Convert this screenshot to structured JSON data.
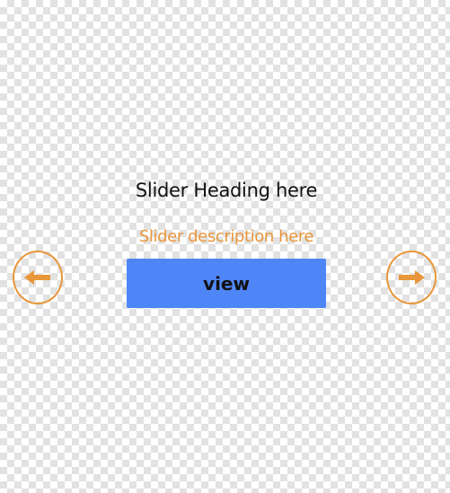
{
  "slider": {
    "heading": "Slider Heading here",
    "description": "Slider description here",
    "button_label": "view",
    "prev_icon": "arrow-left-icon",
    "next_icon": "arrow-right-icon"
  },
  "colors": {
    "accent": "#e8963a",
    "button": "#4f86f7",
    "heading": "#111111"
  }
}
